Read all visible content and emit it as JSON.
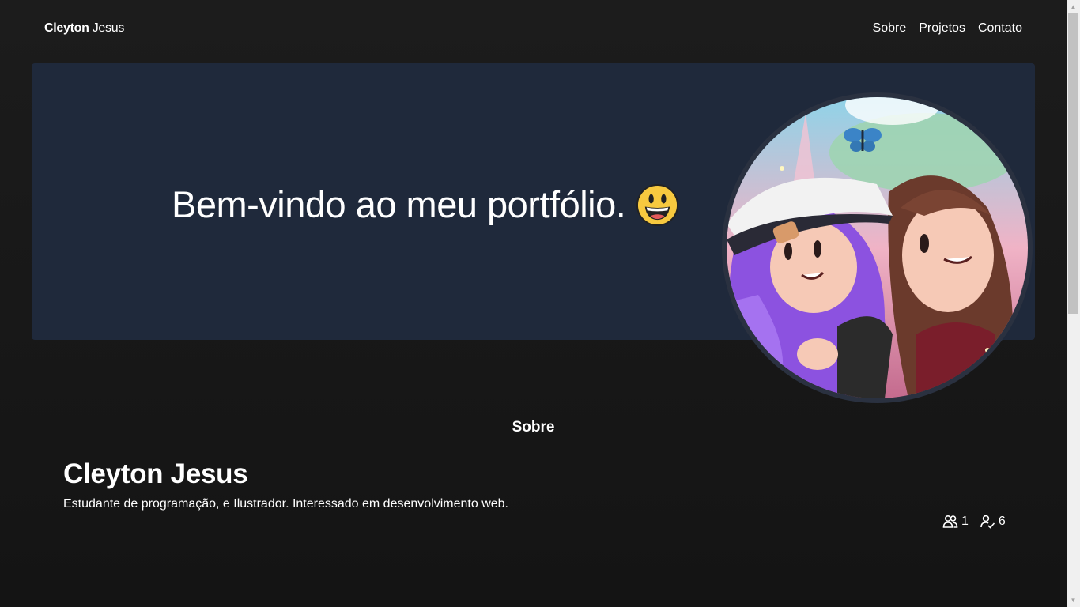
{
  "header": {
    "brand_first": "Cleyton",
    "brand_last": "Jesus",
    "nav": [
      "Sobre",
      "Projetos",
      "Contato"
    ]
  },
  "hero": {
    "title": "Bem-vindo ao meu portfólio.",
    "emoji_icon": "grinning-face-icon"
  },
  "about": {
    "section_title": "Sobre",
    "name": "Cleyton Jesus",
    "bio": "Estudante de programação, e Ilustrador. Interessado em desenvolvimento web.",
    "followers": "1",
    "following": "6"
  },
  "colors": {
    "background": "#181818",
    "hero": "#1f293b",
    "text": "#ffffff"
  }
}
